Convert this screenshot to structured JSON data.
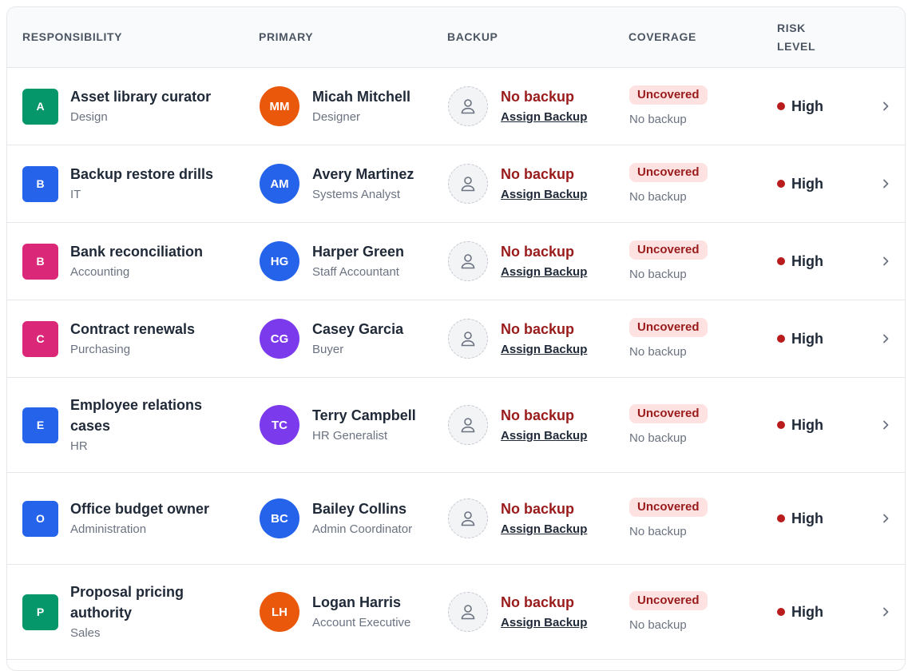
{
  "headers": {
    "responsibility": "RESPONSIBILITY",
    "primary": "PRIMARY",
    "backup": "BACKUP",
    "coverage": "COVERAGE",
    "risk": "RISK LEVEL"
  },
  "rows": [
    {
      "initial": "A",
      "color": "#059669",
      "title": "Asset library curator",
      "dept": "Design",
      "pinit": "MM",
      "pcolor": "#ea580c",
      "pname": "Micah Mitchell",
      "prole": "Designer",
      "nobackup": "No backup",
      "assign": "Assign Backup",
      "badge": "Uncovered",
      "covsub": "No backup",
      "risk": "High"
    },
    {
      "initial": "B",
      "color": "#2563eb",
      "title": "Backup restore drills",
      "dept": "IT",
      "pinit": "AM",
      "pcolor": "#2563eb",
      "pname": "Avery Martinez",
      "prole": "Systems Analyst",
      "nobackup": "No backup",
      "assign": "Assign Backup",
      "badge": "Uncovered",
      "covsub": "No backup",
      "risk": "High"
    },
    {
      "initial": "B",
      "color": "#db2777",
      "title": "Bank reconciliation",
      "dept": "Accounting",
      "pinit": "HG",
      "pcolor": "#2563eb",
      "pname": "Harper Green",
      "prole": "Staff Accountant",
      "nobackup": "No backup",
      "assign": "Assign Backup",
      "badge": "Uncovered",
      "covsub": "No backup",
      "risk": "High"
    },
    {
      "initial": "C",
      "color": "#db2777",
      "title": "Contract renewals",
      "dept": "Purchasing",
      "pinit": "CG",
      "pcolor": "#7c3aed",
      "pname": "Casey Garcia",
      "prole": "Buyer",
      "nobackup": "No backup",
      "assign": "Assign Backup",
      "badge": "Uncovered",
      "covsub": "No backup",
      "risk": "High"
    },
    {
      "initial": "E",
      "color": "#2563eb",
      "title": "Employee relations cases",
      "dept": "HR",
      "pinit": "TC",
      "pcolor": "#7c3aed",
      "pname": "Terry Campbell",
      "prole": "HR Generalist",
      "nobackup": "No backup",
      "assign": "Assign Backup",
      "badge": "Uncovered",
      "covsub": "No backup",
      "risk": "High"
    },
    {
      "initial": "O",
      "color": "#2563eb",
      "title": "Office budget owner",
      "dept": "Administration",
      "pinit": "BC",
      "pcolor": "#2563eb",
      "pname": "Bailey Collins",
      "prole": "Admin Coordinator",
      "nobackup": "No backup",
      "assign": "Assign Backup",
      "badge": "Uncovered",
      "covsub": "No backup",
      "risk": "High"
    },
    {
      "initial": "P",
      "color": "#059669",
      "title": "Proposal pricing authority",
      "dept": "Sales",
      "pinit": "LH",
      "pcolor": "#ea580c",
      "pname": "Logan Harris",
      "prole": "Account Executive",
      "nobackup": "No backup",
      "assign": "Assign Backup",
      "badge": "Uncovered",
      "covsub": "No backup",
      "risk": "High"
    }
  ]
}
